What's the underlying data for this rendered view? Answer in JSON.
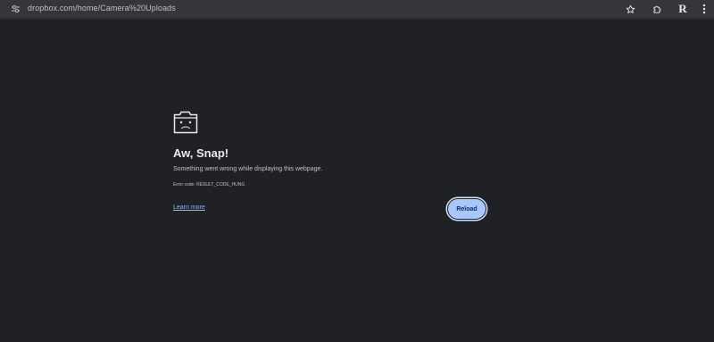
{
  "browser": {
    "url": "dropbox.com/home/Camera%20Uploads",
    "profile_initial": "R",
    "icons": {
      "site_info": "tune-icon",
      "bookmark": "star-icon",
      "extensions": "puzzle-icon",
      "menu": "more-vert-icon"
    }
  },
  "error_page": {
    "icon": "sad-tab-icon",
    "heading": "Aw, Snap!",
    "message": "Something went wrong while displaying this webpage.",
    "error_code": "Error code: RESULT_CODE_HUNG",
    "learn_more": "Learn more",
    "reload_label": "Reload"
  },
  "colors": {
    "background": "#202124",
    "toolbar": "#35363a",
    "link": "#8ab4f8",
    "button": "#a8c7fa"
  }
}
